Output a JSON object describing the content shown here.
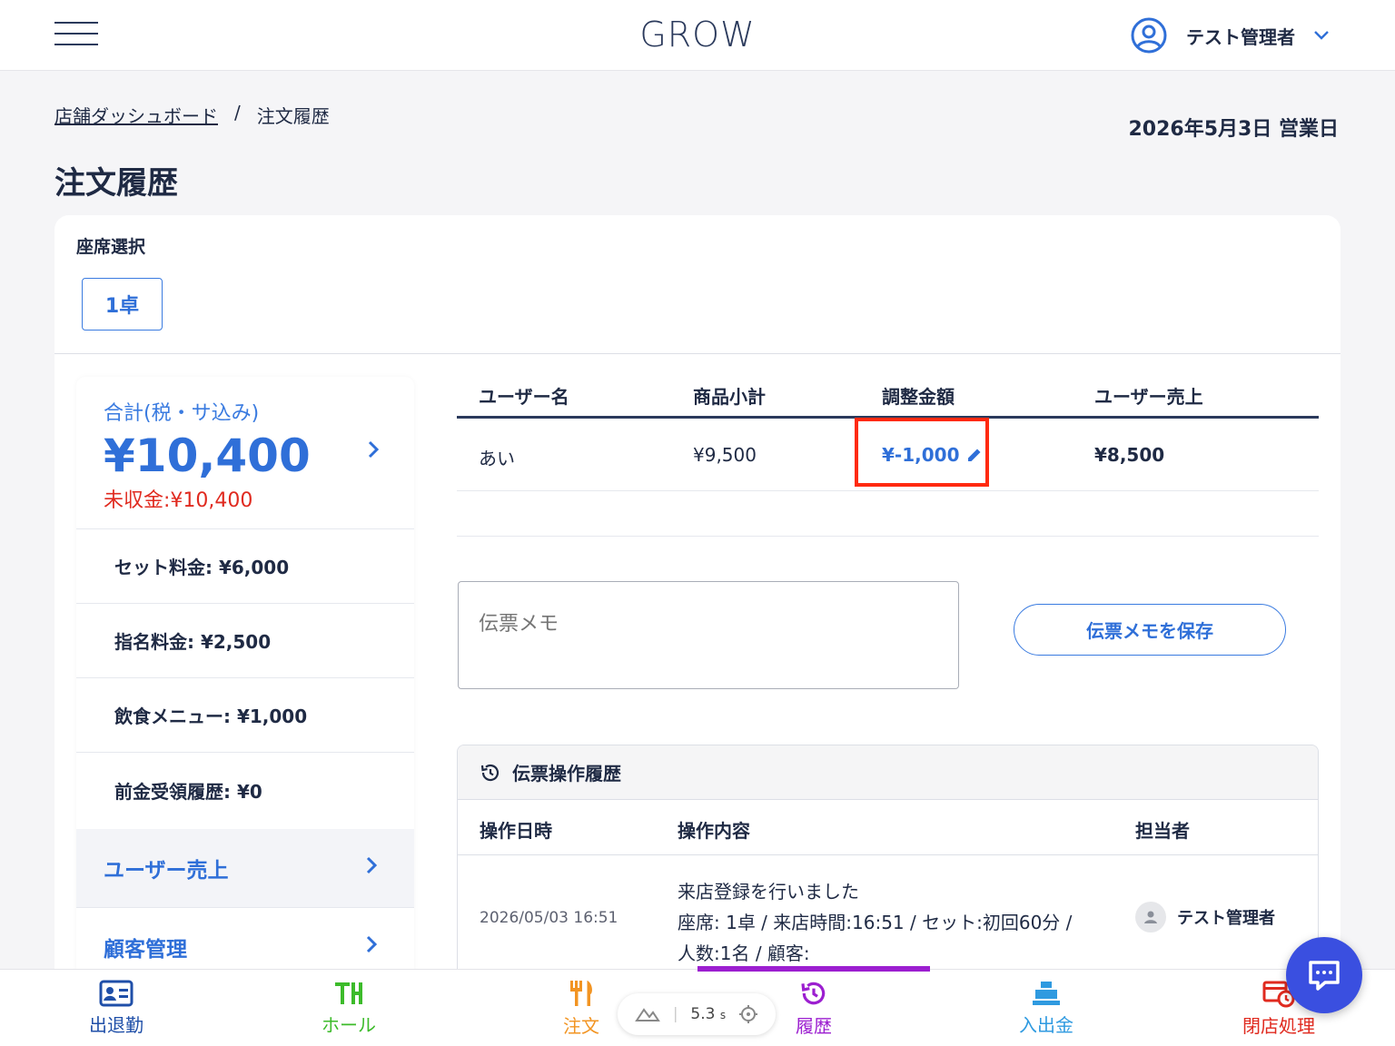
{
  "header": {
    "brand": "GROW",
    "user_name": "テスト管理者"
  },
  "breadcrumb": {
    "home": "店舗ダッシュボード",
    "separator": "/",
    "current": "注文履歴"
  },
  "business_date": "2026年5月3日 営業日",
  "page_title": "注文履歴",
  "seat": {
    "label": "座席選択",
    "selected": "1卓"
  },
  "summary": {
    "total_label": "合計(税・サ込み)",
    "total_amount": "¥10,400",
    "unpaid": "未収金:¥10,400",
    "fees": [
      "セット料金: ¥6,000",
      "指名料金: ¥2,500",
      "飲食メニュー: ¥1,000",
      "前金受領履歴: ¥0"
    ],
    "nav": [
      "ユーザー売上",
      "顧客管理"
    ]
  },
  "user_table": {
    "headers": [
      "ユーザー名",
      "商品小計",
      "調整金額",
      "ユーザー売上"
    ],
    "rows": [
      {
        "name": "あい",
        "subtotal": "¥9,500",
        "adjustment": "¥-1,000",
        "sales": "¥8,500"
      }
    ]
  },
  "memo": {
    "placeholder": "伝票メモ",
    "save_label": "伝票メモを保存"
  },
  "history": {
    "title": "伝票操作履歴",
    "headers": [
      "操作日時",
      "操作内容",
      "担当者"
    ],
    "rows": [
      {
        "datetime": "2026/05/03 16:51",
        "line1": "来店登録を行いました",
        "line2": "座席: 1卓 / 来店時間:16:51 / セット:初回60分 /",
        "line3": "人数:1名 / 顧客:",
        "user": "テスト管理者"
      }
    ]
  },
  "bottom_nav": {
    "tabs": [
      {
        "label": "出退勤",
        "color": "#1f4fa8"
      },
      {
        "label": "ホール",
        "color": "#3cbb2a"
      },
      {
        "label": "注文",
        "color": "#f29422"
      },
      {
        "label": "履歴",
        "color": "#9c1fd0"
      },
      {
        "label": "入出金",
        "color": "#2f9ae0"
      },
      {
        "label": "閉店処理",
        "color": "#e02a1f"
      }
    ],
    "active": "履歴"
  },
  "perf_widget": {
    "value": "5.3",
    "unit": "s"
  }
}
